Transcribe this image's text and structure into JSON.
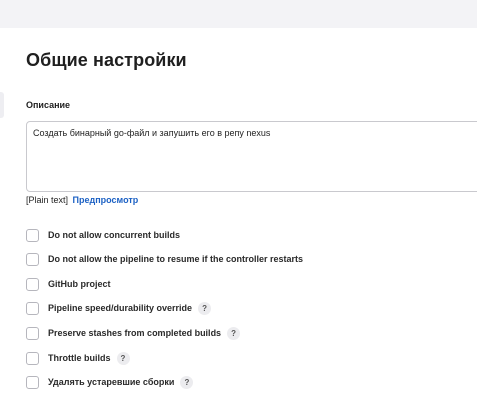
{
  "section": {
    "title": "Общие настройки"
  },
  "description": {
    "label": "Описание",
    "value": "Создать бинарный go-файл и запушить его в репу nexus",
    "format_text": "[Plain text]",
    "preview_link": "Предпросмотр"
  },
  "options": [
    {
      "label": "Do not allow concurrent builds",
      "checked": false,
      "has_help": false
    },
    {
      "label": "Do not allow the pipeline to resume if the controller restarts",
      "checked": false,
      "has_help": false
    },
    {
      "label": "GitHub project",
      "checked": false,
      "has_help": false
    },
    {
      "label": "Pipeline speed/durability override",
      "checked": false,
      "has_help": true
    },
    {
      "label": "Preserve stashes from completed builds",
      "checked": false,
      "has_help": true
    },
    {
      "label": "Throttle builds",
      "checked": false,
      "has_help": true
    },
    {
      "label": "Удалять устаревшие сборки",
      "checked": false,
      "has_help": true
    }
  ],
  "help_glyph": "?"
}
